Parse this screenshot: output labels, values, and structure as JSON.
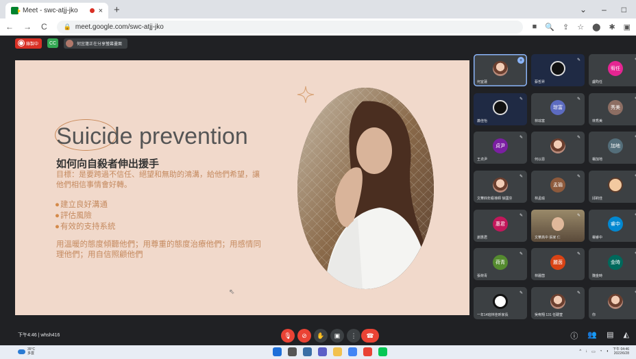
{
  "browser": {
    "tab_title": "Meet - swc-atjj-jko",
    "tab_close": "×",
    "new_tab": "+",
    "window_controls": [
      "⌄",
      "–",
      "□"
    ],
    "url": "meet.google.com/swc-atjj-jko",
    "nav": {
      "back": "←",
      "forward": "→",
      "reload": "C"
    }
  },
  "meet": {
    "recording_label": "錄製中",
    "captions_label": "CC",
    "presenting_label": "何宜蓮正在分享螢幕畫面",
    "meeting_time": "下午4:46",
    "meeting_code": "whsh416"
  },
  "slide": {
    "title": "Suicide prevention",
    "heading": "如何向自殺者伸出援手",
    "goal": "目標：是要跨過不信任、絕望和無助的鴻溝，給他們希望，讓他們相信事情會好轉。",
    "bullets": [
      "建立良好溝通",
      "評估風險",
      "有效的支持系統"
    ],
    "footer": "用溫暖的態度傾聽他們；用尊重的態度治療他們；用感情同理他們；用自信照顧他們"
  },
  "participants": [
    {
      "name": "何宜蓮",
      "initials": "",
      "color": "",
      "kind": "photo",
      "selected": true
    },
    {
      "name": "蔡哲昇",
      "initials": "",
      "color": "",
      "kind": "obs"
    },
    {
      "name": "盧昀任",
      "initials": "宥任",
      "color": "#e52592",
      "kind": "initials"
    },
    {
      "name": "蕭佳怡",
      "initials": "",
      "color": "",
      "kind": "obs"
    },
    {
      "name": "林琮富",
      "initials": "琮富",
      "color": "#5c6bc0",
      "kind": "initials"
    },
    {
      "name": "林秀美",
      "initials": "秀美",
      "color": "#8d6e63",
      "kind": "initials"
    },
    {
      "name": "王貞尹",
      "initials": "貞尹",
      "color": "#7b1fa2",
      "kind": "initials"
    },
    {
      "name": "何以恩",
      "initials": "",
      "color": "",
      "kind": "photo"
    },
    {
      "name": "楊加地",
      "initials": "加地",
      "color": "#546e7a",
      "kind": "initials"
    },
    {
      "name": "文華四年級導師 徐國芬",
      "initials": "",
      "color": "",
      "kind": "photo"
    },
    {
      "name": "林孟瑜",
      "initials": "孟瑜",
      "color": "#8d5a3c",
      "kind": "initials"
    },
    {
      "name": "邱莉佳",
      "initials": "",
      "color": "",
      "kind": "cartoon"
    },
    {
      "name": "謝惠君",
      "initials": "惠君",
      "color": "#c2185b",
      "kind": "initials"
    },
    {
      "name": "文華高中 張家 仁",
      "initials": "",
      "color": "",
      "kind": "video"
    },
    {
      "name": "楊睿中",
      "initials": "睿中",
      "color": "#0288d1",
      "kind": "initials"
    },
    {
      "name": "張荷青",
      "initials": "荷青",
      "color": "#558b2f",
      "kind": "initials"
    },
    {
      "name": "林麗茵",
      "initials": "麗茵",
      "color": "#d84315",
      "kind": "initials"
    },
    {
      "name": "魏金時",
      "initials": "金時",
      "color": "#00695c",
      "kind": "initials"
    },
    {
      "name": "一年14班林佳昕家長",
      "initials": "",
      "color": "",
      "kind": "panda"
    },
    {
      "name": "吳宥翔 131 任聰萱",
      "initials": "",
      "color": "",
      "kind": "photo"
    },
    {
      "name": "你",
      "initials": "",
      "color": "",
      "kind": "photo"
    }
  ],
  "taskbar": {
    "temp": "35°C",
    "weather": "多雲",
    "time": "下午 04:46",
    "date": "2022/6/28"
  }
}
